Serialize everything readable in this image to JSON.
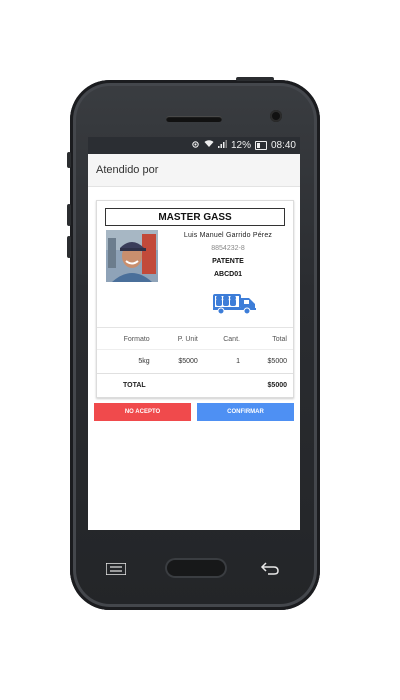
{
  "status_bar": {
    "battery": "12%",
    "time": "08:40",
    "icons": [
      "location-icon",
      "wifi-icon",
      "signal-icon",
      "battery-icon"
    ]
  },
  "header": {
    "title": "Atendido por"
  },
  "card": {
    "company": "MASTER GASS",
    "driver_name": "Luis Manuel Garrido Pérez",
    "rut": "8854232-8",
    "plate_label": "PATENTE",
    "plate": "ABCD01",
    "truck_color": "#3d7dd8"
  },
  "table": {
    "headers": [
      "Formato",
      "P. Unit",
      "Cant.",
      "Total"
    ],
    "rows": [
      {
        "formato": "5kg",
        "unit": "$5000",
        "qty": "1",
        "total": "$5000"
      }
    ],
    "total_label": "TOTAL",
    "total_value": "$5000"
  },
  "actions": {
    "reject": "NO ACEPTO",
    "confirm": "CONFIRMAR",
    "reject_color": "#f04a4c",
    "confirm_color": "#4e90f3"
  }
}
